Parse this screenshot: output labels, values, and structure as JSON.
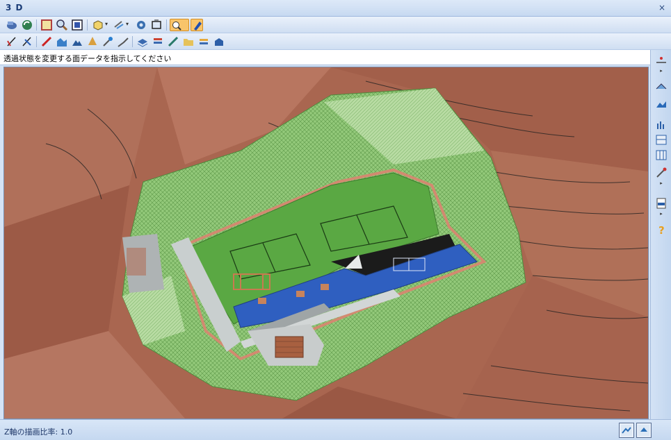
{
  "window": {
    "title": "3 D",
    "close_symbol": "×"
  },
  "toolbar1": {
    "icons": [
      "view-model-icon",
      "refresh-view-icon",
      "fit-extents-icon",
      "zoom-icon",
      "zoom-window-icon",
      "view-cube-icon",
      "rotate-view-icon",
      "settings-gear-icon",
      "capture-icon",
      "transparency-tool-icon",
      "surface-paint-icon"
    ]
  },
  "toolbar2": {
    "icons": [
      "edit-line-icon",
      "edit-line-alt-icon",
      "draw-red-line-icon",
      "area-chart-icon",
      "terrain-icon",
      "tree-icon",
      "tools-icon",
      "survey-icon",
      "layers-icon",
      "stack-icon",
      "pen-icon",
      "folder-icon",
      "blue-box-icon"
    ]
  },
  "prompt": {
    "text": "透過状態を変更する面データを指示してください"
  },
  "sidebar": {
    "icons": [
      "marker-icon",
      "surface-icon",
      "mountain-icon",
      "bar-chart-icon",
      "grid-chart-icon",
      "table-chart-icon",
      "tool-icon",
      "dwg-file-icon",
      "help-icon"
    ]
  },
  "status": {
    "text": "Z軸の描画比率: 1.0"
  },
  "colors": {
    "terrain": "#a96650",
    "mesh": "#8fc873",
    "court": "#4a9a38",
    "pool": "#2f5fc0"
  }
}
